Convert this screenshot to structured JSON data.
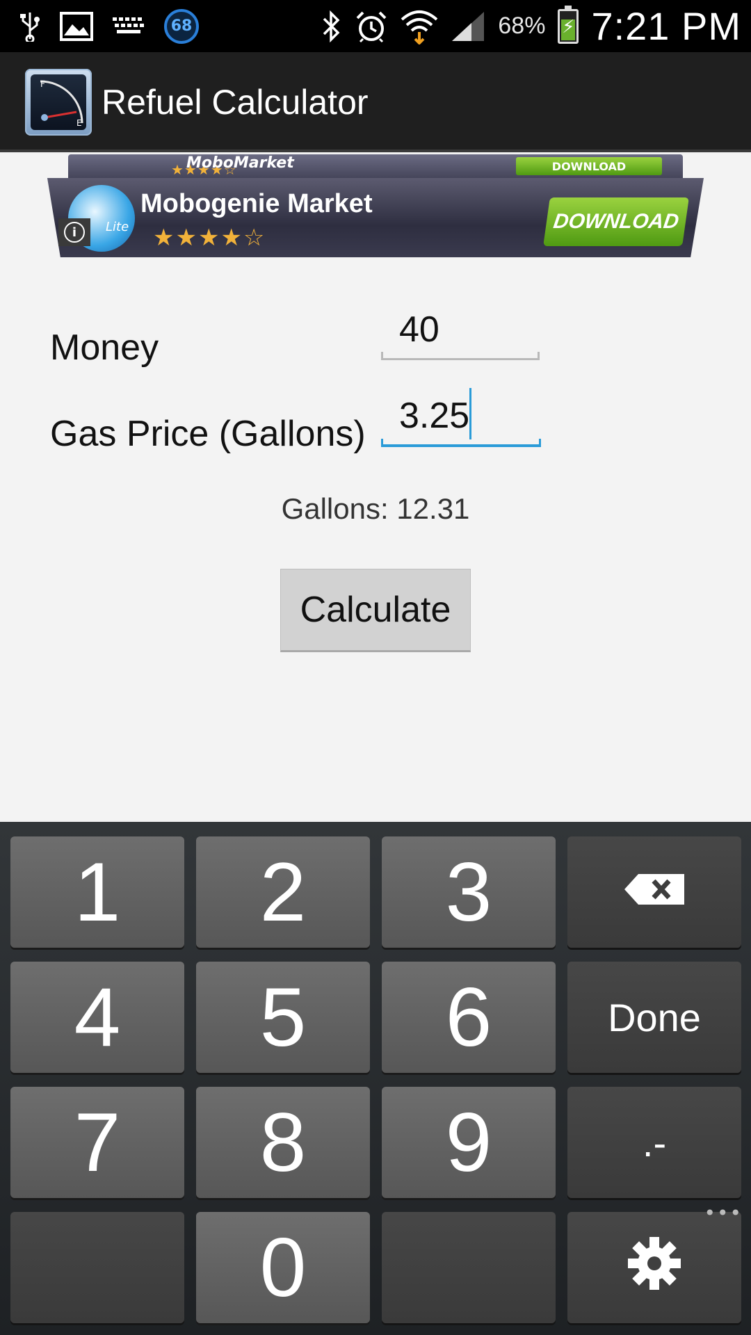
{
  "status_bar": {
    "notification_badge": "68",
    "battery_percent": "68%",
    "time": "7:21 PM",
    "icons": [
      "usb-icon",
      "image-icon",
      "keyboard-icon",
      "bluetooth-icon",
      "alarm-icon",
      "wifi-icon",
      "signal-icon",
      "battery-charging-icon"
    ]
  },
  "action_bar": {
    "title": "Refuel Calculator"
  },
  "ad": {
    "small_title": "MoboMarket",
    "small_download": "DOWNLOAD",
    "title": "Mobogenie Market",
    "stars": "★★★★☆",
    "download_label": "DOWNLOAD",
    "logo_text": "Lite",
    "info": "i"
  },
  "form": {
    "money_label": "Money",
    "money_value": "40",
    "gas_price_label": "Gas Price (Gallons)",
    "gas_price_value": "3.25",
    "result": "Gallons: 12.31",
    "calculate_label": "Calculate"
  },
  "keypad": {
    "keys": [
      "1",
      "2",
      "3",
      "4",
      "5",
      "6",
      "Done",
      "7",
      "8",
      "9",
      ".-",
      "0"
    ],
    "done_label": "Done",
    "decimal_label": ".-"
  },
  "colors": {
    "accent": "#2a9bd8",
    "status_bar": "#000000",
    "action_bar": "#1f1f1f",
    "ad_button": "#6fb325"
  }
}
